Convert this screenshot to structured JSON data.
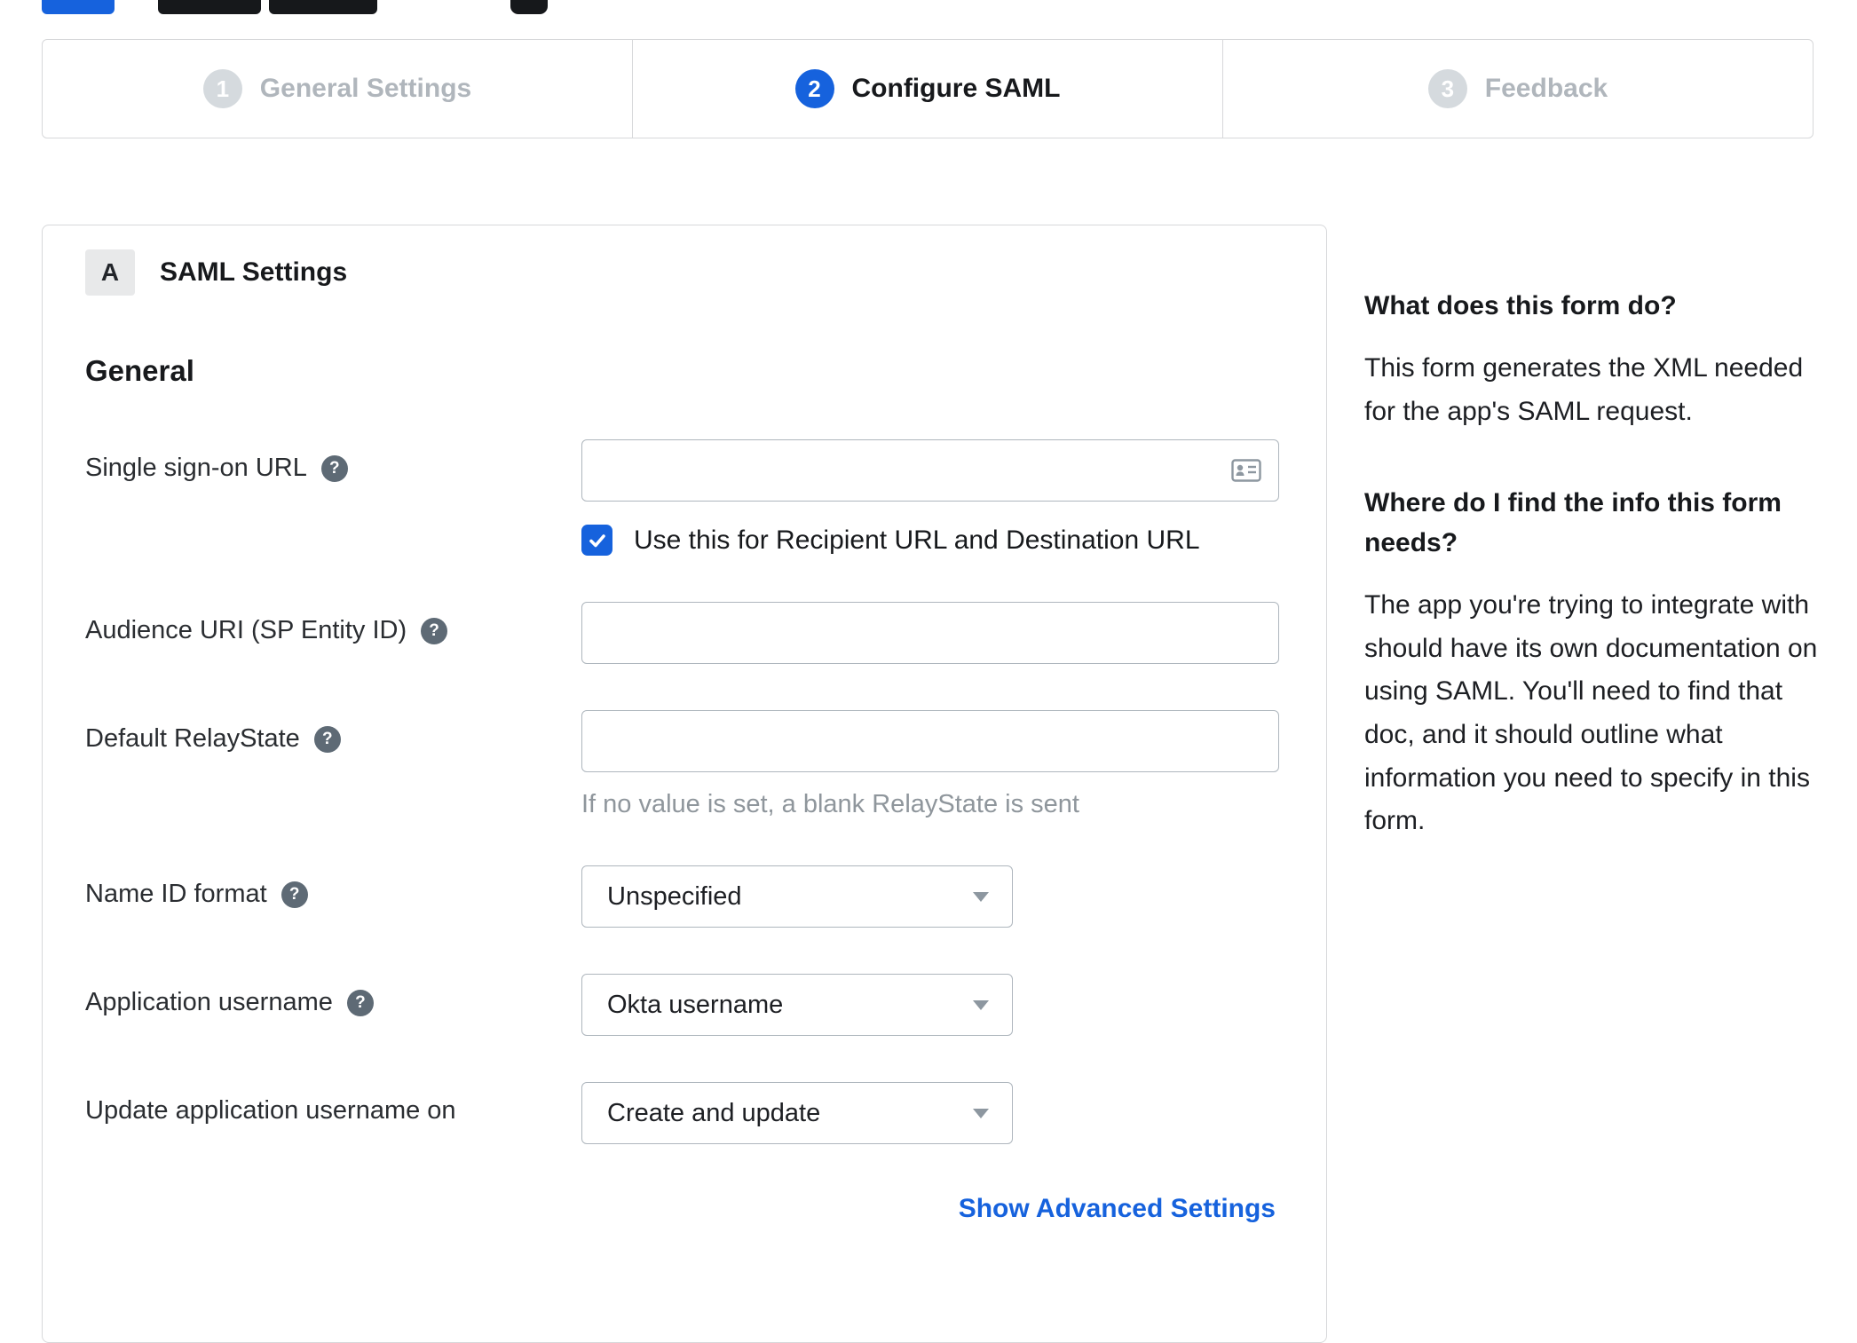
{
  "stepper": {
    "steps": [
      {
        "number": "1",
        "label": "General Settings",
        "state": "inactive"
      },
      {
        "number": "2",
        "label": "Configure SAML",
        "state": "active"
      },
      {
        "number": "3",
        "label": "Feedback",
        "state": "inactive"
      }
    ]
  },
  "panel": {
    "badge": "A",
    "title": "SAML Settings",
    "section_title": "General",
    "fields": {
      "sso_url": {
        "label": "Single sign-on URL",
        "value": ""
      },
      "sso_checkbox": {
        "label": "Use this for Recipient URL and Destination URL",
        "checked": true
      },
      "audience_uri": {
        "label": "Audience URI (SP Entity ID)",
        "value": ""
      },
      "relay_state": {
        "label": "Default RelayState",
        "value": "",
        "help_text": "If no value is set, a blank RelayState is sent"
      },
      "name_id_format": {
        "label": "Name ID format",
        "value": "Unspecified"
      },
      "app_username": {
        "label": "Application username",
        "value": "Okta username"
      },
      "update_app_username": {
        "label": "Update application username on",
        "value": "Create and update"
      }
    },
    "advanced_link": "Show Advanced Settings"
  },
  "sidebar": {
    "sections": [
      {
        "heading": "What does this form do?",
        "body": "This form generates the XML needed for the app's SAML request."
      },
      {
        "heading": "Where do I find the info this form needs?",
        "body": "The app you're trying to integrate with should have its own documentation on using SAML. You'll need to find that doc, and it should outline what information you need to specify in this form."
      }
    ]
  },
  "glyphs": {
    "question": "?"
  },
  "colors": {
    "accent_blue": "#1662dd",
    "inactive_gray": "#b0b6bc",
    "border_gray": "#d7d8da"
  }
}
